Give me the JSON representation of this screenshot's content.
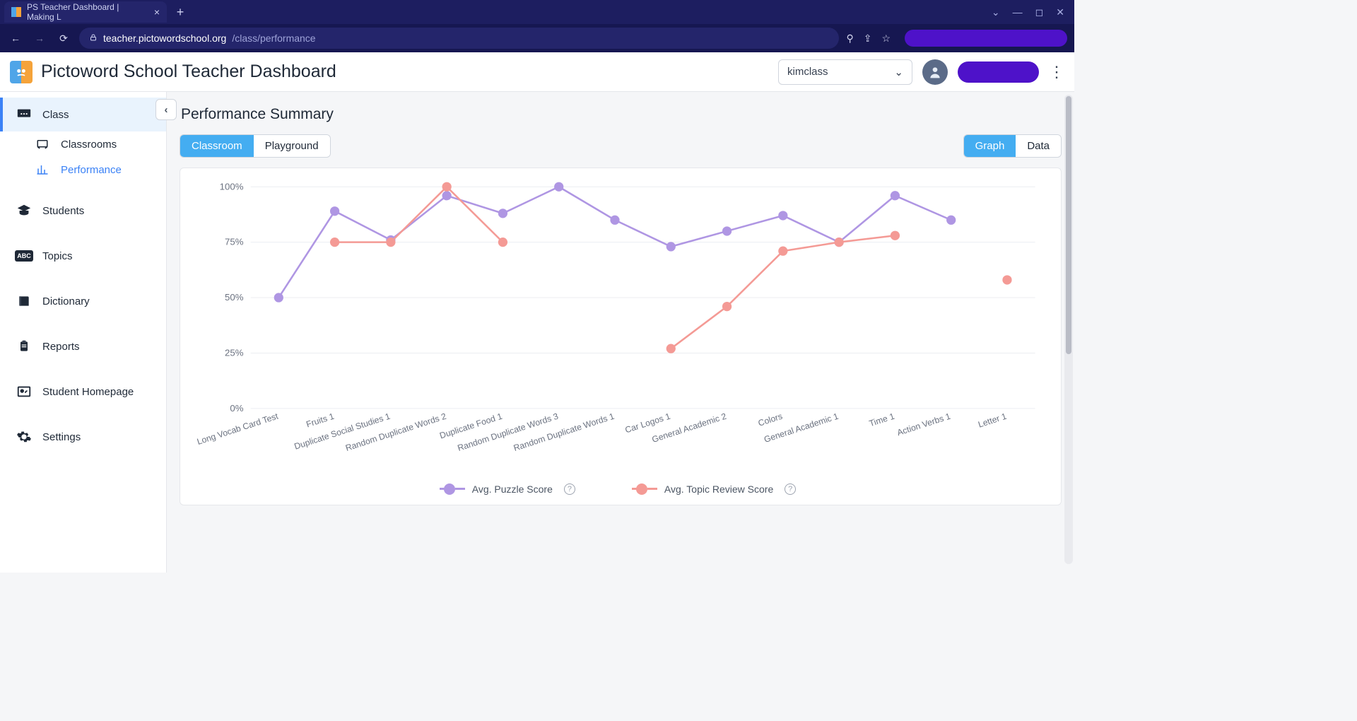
{
  "browser": {
    "tab_title": "PS Teacher Dashboard | Making L",
    "url_host": "teacher.pictowordschool.org",
    "url_path": "/class/performance"
  },
  "header": {
    "app_title": "Pictoword School Teacher Dashboard",
    "class_selected": "kimclass"
  },
  "sidebar": {
    "class_label": "Class",
    "classrooms_label": "Classrooms",
    "performance_label": "Performance",
    "students_label": "Students",
    "topics_label": "Topics",
    "dictionary_label": "Dictionary",
    "reports_label": "Reports",
    "student_homepage_label": "Student Homepage",
    "settings_label": "Settings"
  },
  "page": {
    "title": "Performance Summary",
    "tab_classroom": "Classroom",
    "tab_playground": "Playground",
    "view_graph": "Graph",
    "view_data": "Data"
  },
  "legend": {
    "puzzle": "Avg. Puzzle Score",
    "review": "Avg. Topic Review Score"
  },
  "chart_data": {
    "type": "line",
    "xlabel": "",
    "ylabel": "",
    "ylim": [
      0,
      100
    ],
    "yticks": [
      0,
      25,
      50,
      75,
      100
    ],
    "ytick_labels": [
      "0%",
      "25%",
      "50%",
      "75%",
      "100%"
    ],
    "categories": [
      "Long Vocab Card Test",
      "Fruits 1",
      "Duplicate Social Studies 1",
      "Random Duplicate Words 2",
      "Duplicate Food 1",
      "Random Duplicate Words 3",
      "Random Duplicate Words 1",
      "Car Logos 1",
      "General Academic 2",
      "Colors",
      "General Academic 1",
      "Time 1",
      "Action Verbs 1",
      "Letter 1"
    ],
    "series": [
      {
        "name": "Avg. Puzzle Score",
        "color": "#af96e3",
        "values": [
          50,
          89,
          76,
          96,
          88,
          100,
          85,
          73,
          80,
          87,
          75,
          96,
          85,
          null
        ]
      },
      {
        "name": "Avg. Topic Review Score",
        "color": "#f49a95",
        "values": [
          null,
          75,
          75,
          100,
          75,
          null,
          null,
          27,
          46,
          71,
          75,
          78,
          null,
          58
        ]
      }
    ]
  }
}
